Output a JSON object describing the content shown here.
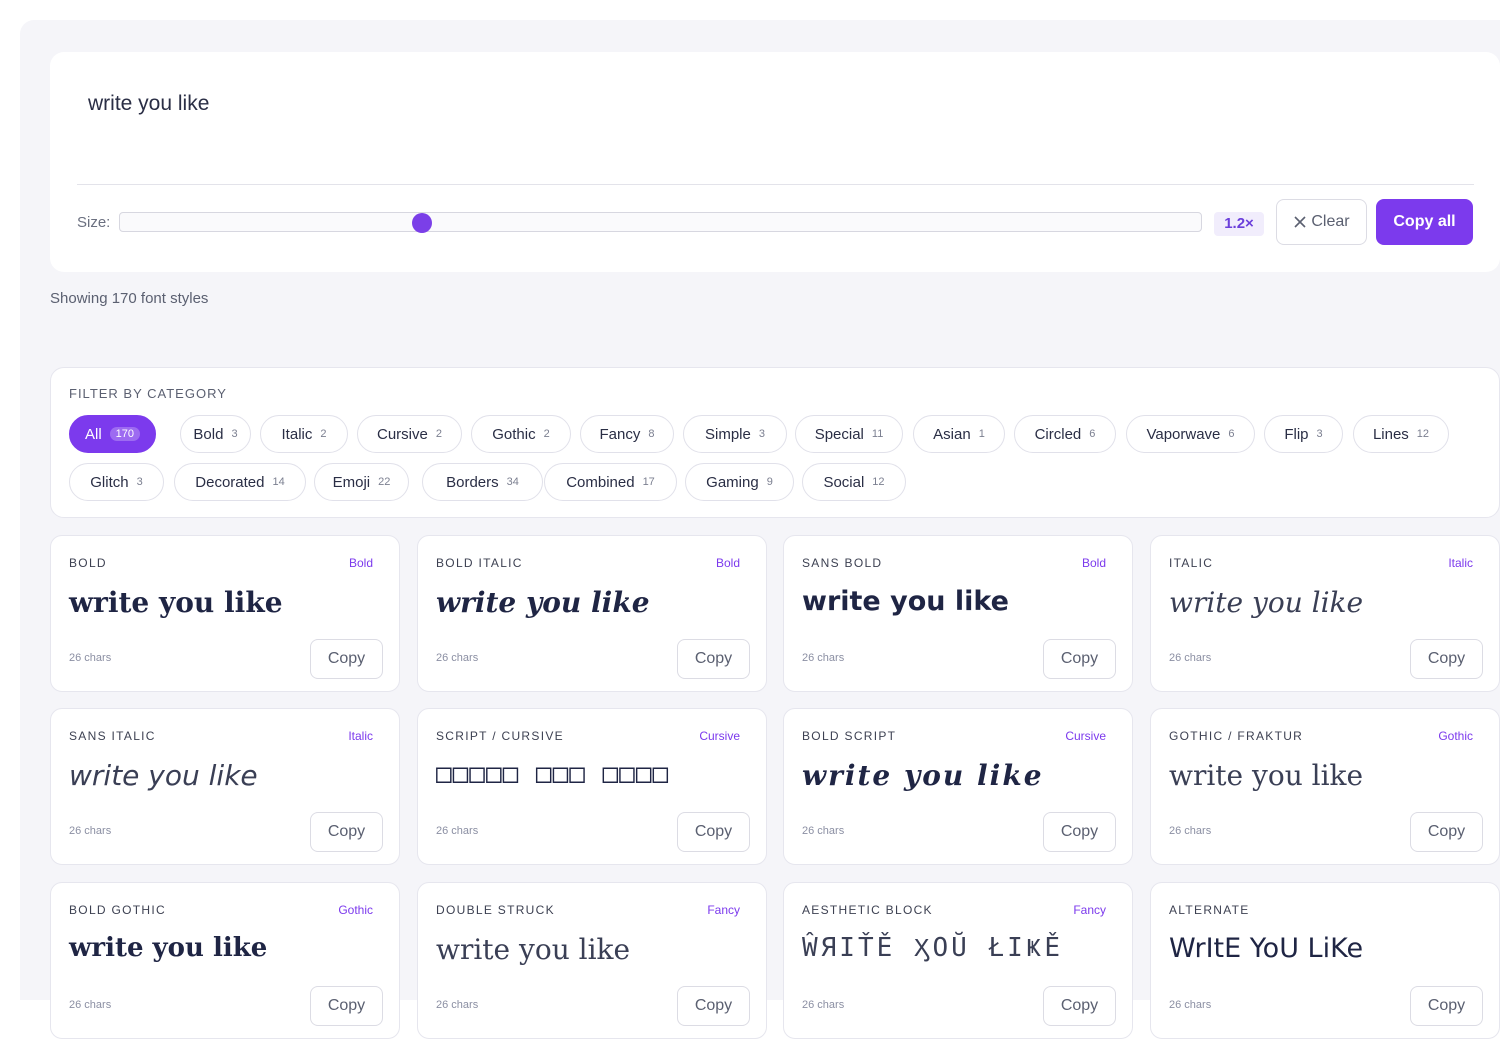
{
  "editor": {
    "text": "write you like",
    "size_label": "Size:",
    "size_level": 0.28,
    "size_value": "1.2×",
    "clear_label": "Clear",
    "copy_all_label": "Copy all"
  },
  "showing_text": "Showing 170 font styles",
  "filter": {
    "title": "FILTER BY CATEGORY",
    "categories": [
      {
        "label": "All",
        "count": "170",
        "active": true
      },
      {
        "label": "Bold",
        "count": "3"
      },
      {
        "label": "Italic",
        "count": "2"
      },
      {
        "label": "Cursive",
        "count": "2"
      },
      {
        "label": "Gothic",
        "count": "2"
      },
      {
        "label": "Fancy",
        "count": "8"
      },
      {
        "label": "Simple",
        "count": "3"
      },
      {
        "label": "Special",
        "count": "11"
      },
      {
        "label": "Asian",
        "count": "1"
      },
      {
        "label": "Circled",
        "count": "6"
      },
      {
        "label": "Vaporwave",
        "count": "6"
      },
      {
        "label": "Flip",
        "count": "3"
      },
      {
        "label": "Lines",
        "count": "12"
      },
      {
        "label": "Glitch",
        "count": "3"
      },
      {
        "label": "Decorated",
        "count": "14"
      },
      {
        "label": "Emoji",
        "count": "22"
      },
      {
        "label": "Borders",
        "count": "34"
      },
      {
        "label": "Combined",
        "count": "17"
      },
      {
        "label": "Gaming",
        "count": "9"
      },
      {
        "label": "Social",
        "count": "12"
      }
    ]
  },
  "cards": [
    {
      "name": "BOLD",
      "badge": "Bold",
      "sample": "write you like",
      "chars": "26 chars",
      "copy": "Copy"
    },
    {
      "name": "BOLD ITALIC",
      "badge": "Bold",
      "sample": "write you like",
      "chars": "26 chars",
      "copy": "Copy"
    },
    {
      "name": "SANS BOLD",
      "badge": "Bold",
      "sample": "write you like",
      "chars": "26 chars",
      "copy": "Copy"
    },
    {
      "name": "ITALIC",
      "badge": "Italic",
      "sample": "write you like",
      "chars": "26 chars",
      "copy": "Copy"
    },
    {
      "name": "SANS ITALIC",
      "badge": "Italic",
      "sample": "write you like",
      "chars": "26 chars",
      "copy": "Copy"
    },
    {
      "name": "SCRIPT / CURSIVE",
      "badge": "Cursive",
      "sample": "□□□□□ □□□ □□□□",
      "chars": "26 chars",
      "copy": "Copy"
    },
    {
      "name": "BOLD SCRIPT",
      "badge": "Cursive",
      "sample": "write you like",
      "chars": "26 chars",
      "copy": "Copy"
    },
    {
      "name": "GOTHIC / FRAKTUR",
      "badge": "Gothic",
      "sample": "write you like",
      "chars": "26 chars",
      "copy": "Copy"
    },
    {
      "name": "BOLD GOTHIC",
      "badge": "Gothic",
      "sample": "write you like",
      "chars": "26 chars",
      "copy": "Copy"
    },
    {
      "name": "DOUBLE STRUCK",
      "badge": "Fancy",
      "sample": "write you like",
      "chars": "26 chars",
      "copy": "Copy"
    },
    {
      "name": "AESTHETIC BLOCK",
      "badge": "Fancy",
      "sample": "ŴЯIŤĚ ӼOŬ ŁIҜĚ",
      "chars": "26 chars",
      "copy": "Copy"
    },
    {
      "name": "ALTERNATE",
      "badge": "",
      "sample": "WrItE YoU LiKe",
      "chars": "26 chars",
      "copy": "Copy"
    }
  ],
  "colors": {
    "accent": "#7c3aed",
    "background": "#f5f5f9"
  }
}
